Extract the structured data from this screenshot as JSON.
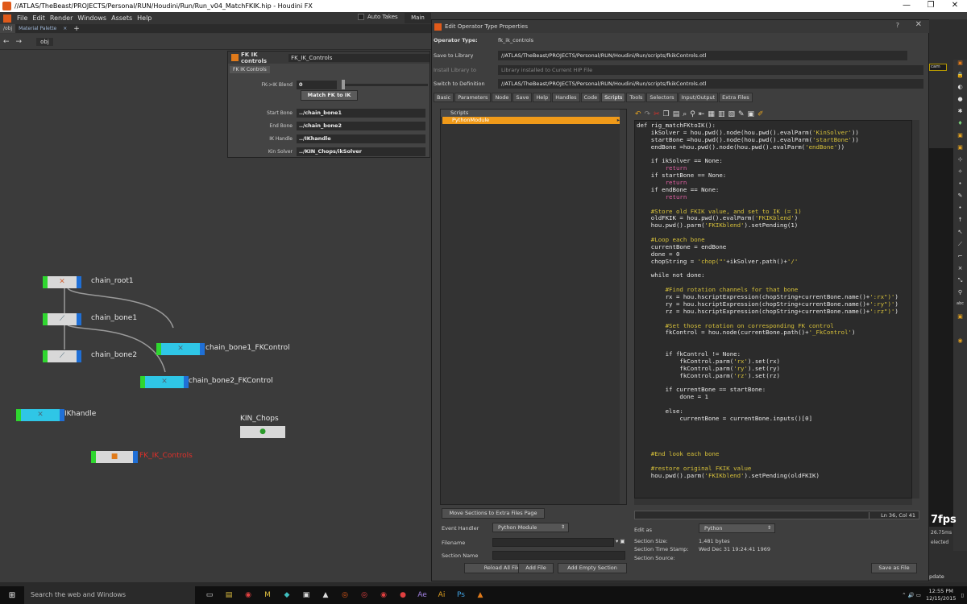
{
  "window": {
    "title": "//ATLAS/TheBeast/PROJECTS/Personal/RUN/Houdini/Run/Run_v04_MatchFKIK.hip - Houdini FX",
    "controls": [
      "—",
      "❐",
      "✕"
    ]
  },
  "menubar": {
    "items": [
      "File",
      "Edit",
      "Render",
      "Windows",
      "Assets",
      "Help"
    ],
    "auto_takes": "Auto Takes",
    "desktop": "Main"
  },
  "tabs": {
    "items": [
      "/obj",
      "Material Palette"
    ],
    "close": "×",
    "add": "+"
  },
  "pathbar": {
    "back": "←",
    "forward": "→",
    "path": "obj"
  },
  "network": {
    "nodes": [
      {
        "id": "chain_root1",
        "label": "chain_root1",
        "glyph": "✕"
      },
      {
        "id": "chain_bone1",
        "label": "chain_bone1",
        "glyph": "⟋"
      },
      {
        "id": "chain_bone2",
        "label": "chain_bone2",
        "glyph": "⟋"
      },
      {
        "id": "chain_bone1_FKControl",
        "label": "chain_bone1_FKControl",
        "glyph": "✕"
      },
      {
        "id": "chain_bone2_FKControl",
        "label": "chain_bone2_FKControl",
        "glyph": "✕"
      },
      {
        "id": "IKhandle",
        "label": "IKhandle",
        "glyph": "✕"
      },
      {
        "id": "KIN_Chops",
        "label": "KIN_Chops",
        "glyph": "●"
      },
      {
        "id": "FK_IK_Controls",
        "label": "FK_IK_Controls",
        "glyph": "■"
      }
    ]
  },
  "parm_panel": {
    "node_type": "FK IK controls",
    "node_name": "FK_IK_Controls",
    "folder": "FK IK Controls",
    "blend_label": "FK->IK Blend",
    "blend_value": "0",
    "match_button": "Match FK to IK",
    "start_bone_label": "Start Bone",
    "start_bone_value": "../chain_bone1",
    "end_bone_label": "End Bone",
    "end_bone_value": "../chain_bone2",
    "ik_handle_label": "IK Handle",
    "ik_handle_value": "../IKhandle",
    "kin_solver_label": "Kin Solver",
    "kin_solver_value": "../KIN_Chops/ikSolver"
  },
  "dialog": {
    "title": "Edit Operator Type Properties",
    "help": "?",
    "close": "✕",
    "operator_type_label": "Operator Type:",
    "operator_type_value": "fk_ik_controls",
    "save_to_library_label": "Save to Library",
    "save_to_library_value": "//ATLAS/TheBeast/PROJECTS/Personal/RUN/Houdini/Run/scripts/fkikControls.otl",
    "install_library_label": "Install Library to",
    "install_library_value": "Library installed to Current HIP File",
    "switch_definition_label": "Switch to Definition",
    "switch_definition_value": "//ATLAS/TheBeast/PROJECTS/Personal/RUN/Houdini/Run/scripts/fkikControls.otl",
    "tabs": [
      "Basic",
      "Parameters",
      "Node",
      "Save",
      "Help",
      "Handles",
      "Code",
      "Scripts",
      "Tools",
      "Selectors",
      "Input/Output",
      "Extra Files"
    ],
    "active_tab": "Scripts",
    "scripts_header": "Scripts",
    "scripts_item": "PythonModule",
    "cursor_position": "Ln 36, Col 41",
    "move_sections_button": "Move Sections to Extra Files Page",
    "event_handler_label": "Event Handler",
    "event_handler_value": "Python Module",
    "filename_label": "Filename",
    "section_name_label": "Section Name",
    "reload_button": "Reload All Files",
    "add_file_button": "Add File",
    "add_empty_button": "Add Empty Section",
    "edit_as_label": "Edit as",
    "edit_as_value": "Python",
    "section_size_label": "Section Size:",
    "section_size_value": "1,481 bytes",
    "section_time_label": "Section Time Stamp:",
    "section_time_value": "Wed Dec 31 19:24:41 1969",
    "section_source_label": "Section Source:",
    "save_as_file_button": "Save as File",
    "code_lines": [
      "def rig_matchFKtoIK():",
      "    ikSolver = hou.pwd().node(hou.pwd().evalParm('KinSolver'))",
      "    startBone =hou.pwd().node(hou.pwd().evalParm('startBone'))",
      "    endBone =hou.pwd().node(hou.pwd().evalParm('endBone'))",
      "",
      "    if ikSolver == None:",
      "        return",
      "    if startBone == None:",
      "        return",
      "    if endBone == None:",
      "        return",
      "",
      "    #Store old FKIK value, and set to IK (= 1)",
      "    oldFKIK = hou.pwd().evalParm('FKIKblend')",
      "    hou.pwd().parm('FKIKblend').setPending(1)",
      "",
      "    #Loop each bone",
      "    currentBone = endBone",
      "    done = 0",
      "    chopString = 'chop(\"'+ikSolver.path()+'/'",
      "",
      "    while not done:",
      "",
      "        #Find rotation channels for that bone",
      "        rx = hou.hscriptExpression(chopString+currentBone.name()+':rx\")')",
      "        ry = hou.hscriptExpression(chopString+currentBone.name()+':ry\")')",
      "        rz = hou.hscriptExpression(chopString+currentBone.name()+':rz\")')",
      "",
      "        #Set those rotation on corresponding FK control",
      "        fkControl = hou.node(currentBone.path()+'_FkControl')",
      "",
      "",
      "        if fkControl != None:",
      "            fkControl.parm('rx').set(rx)",
      "            fkControl.parm('ry').set(ry)",
      "            fkControl.parm('rz').set(rz)",
      "",
      "        if currentBone == startBone:",
      "            done = 1",
      "",
      "        else:",
      "            currentBone = currentBone.inputs()[0]",
      "",
      "",
      "",
      "",
      "    #End look each bone",
      "",
      "    #restore original FKIK value",
      "    hou.pwd().parm('FKIKblend').setPending(oldFKIK)"
    ]
  },
  "viewport": {
    "camera": "cam",
    "fps": "7fps",
    "ms": "26.75ms",
    "selected": "elected",
    "update": "pdate"
  },
  "taskbar": {
    "search": "Search the web and Windows",
    "time": "12:55 PM",
    "date": "12/15/2015"
  },
  "colors": {
    "node_blue": "#1f6fd6",
    "node_green": "#2fd62f",
    "node_cyan": "#2fc6e6",
    "selection_orange": "#f09a19",
    "error_red": "#e0302a"
  }
}
